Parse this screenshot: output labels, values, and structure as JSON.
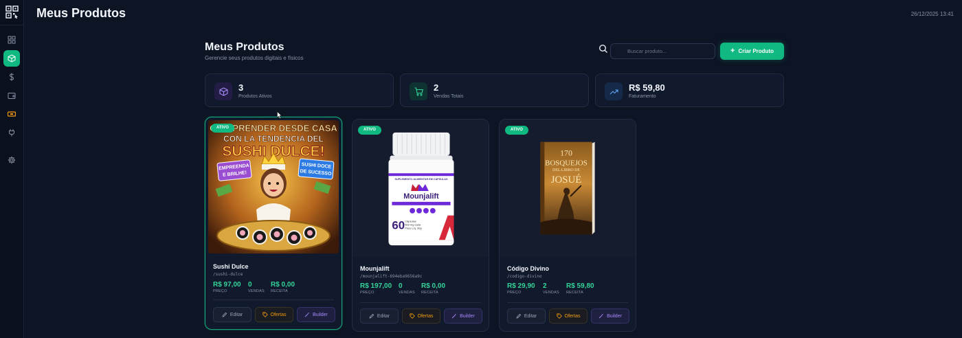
{
  "app": {
    "page_title": "Meus Produtos",
    "datetime": "26/12/2025 13:41"
  },
  "sidebar": {
    "items": [
      {
        "icon": "dashboard-icon",
        "active": false
      },
      {
        "icon": "box-icon",
        "active": true
      },
      {
        "icon": "dollar-icon",
        "active": false
      },
      {
        "icon": "wallet-icon",
        "active": false
      },
      {
        "icon": "ticket-icon",
        "active": false
      },
      {
        "icon": "plug-icon",
        "active": false
      },
      {
        "icon": "gear-icon",
        "active": false
      }
    ]
  },
  "header": {
    "title": "Meus Produtos",
    "subtitle": "Gerencie seus produtos digitais e físicos",
    "search_placeholder": "Buscar produto...",
    "create_label": "Criar Produto"
  },
  "stats": [
    {
      "value": "3",
      "label": "Produtos Ativos",
      "icon": "box-icon",
      "color": "#a78bfa"
    },
    {
      "value": "2",
      "label": "Vendas Totais",
      "icon": "cart-icon",
      "color": "#34d399"
    },
    {
      "value": "R$ 59,80",
      "label": "Faturamento",
      "icon": "trending-up-icon",
      "color": "#60a5fa"
    }
  ],
  "labels": {
    "price": "PREÇO",
    "sales": "VENDAS",
    "revenue": "RECEITA",
    "edit": "Editar",
    "offers": "Ofertas",
    "builder": "Builder"
  },
  "products": [
    {
      "status": "ATIVO",
      "name": "Sushi Dulce",
      "slug": "/sushi-dulce",
      "price": "R$ 97,00",
      "sales": "0",
      "revenue": "R$ 0,00",
      "image_text": {
        "line1": "O EMPRENDER DESDE CASA",
        "line2": "CON LA TENDENCIA DEL",
        "line3": "SUSHI DULCE!",
        "tag_left": "EMPREENDA E BRILHE!",
        "tag_right": "SUSHI DOCE DE SUCESSO"
      }
    },
    {
      "status": "ATIVO",
      "name": "Mounjalift",
      "slug": "/mounjalift-694eba9656a9c",
      "price": "R$ 197,00",
      "sales": "0",
      "revenue": "R$ 0,00",
      "image_text": {
        "brand": "Mounjalift",
        "top": "SUPLEMENTO ALIMENTAR EM CÁPSULAS",
        "count": "60",
        "caps": "Cápsulas",
        "dose": "500 mg cada",
        "weight": "Peso Líq. 30g"
      }
    },
    {
      "status": "ATIVO",
      "name": "Código Divino",
      "slug": "/codigo-divino",
      "price": "R$ 29,90",
      "sales": "2",
      "revenue": "R$ 59,80",
      "image_text": {
        "line1": "170",
        "line2": "BOSQUEJOS",
        "line3": "DEL LIBRO DE",
        "line4": "JOSUÉ"
      }
    }
  ],
  "colors": {
    "accent": "#10b981",
    "background": "#0d1424",
    "card": "#111a2c"
  }
}
